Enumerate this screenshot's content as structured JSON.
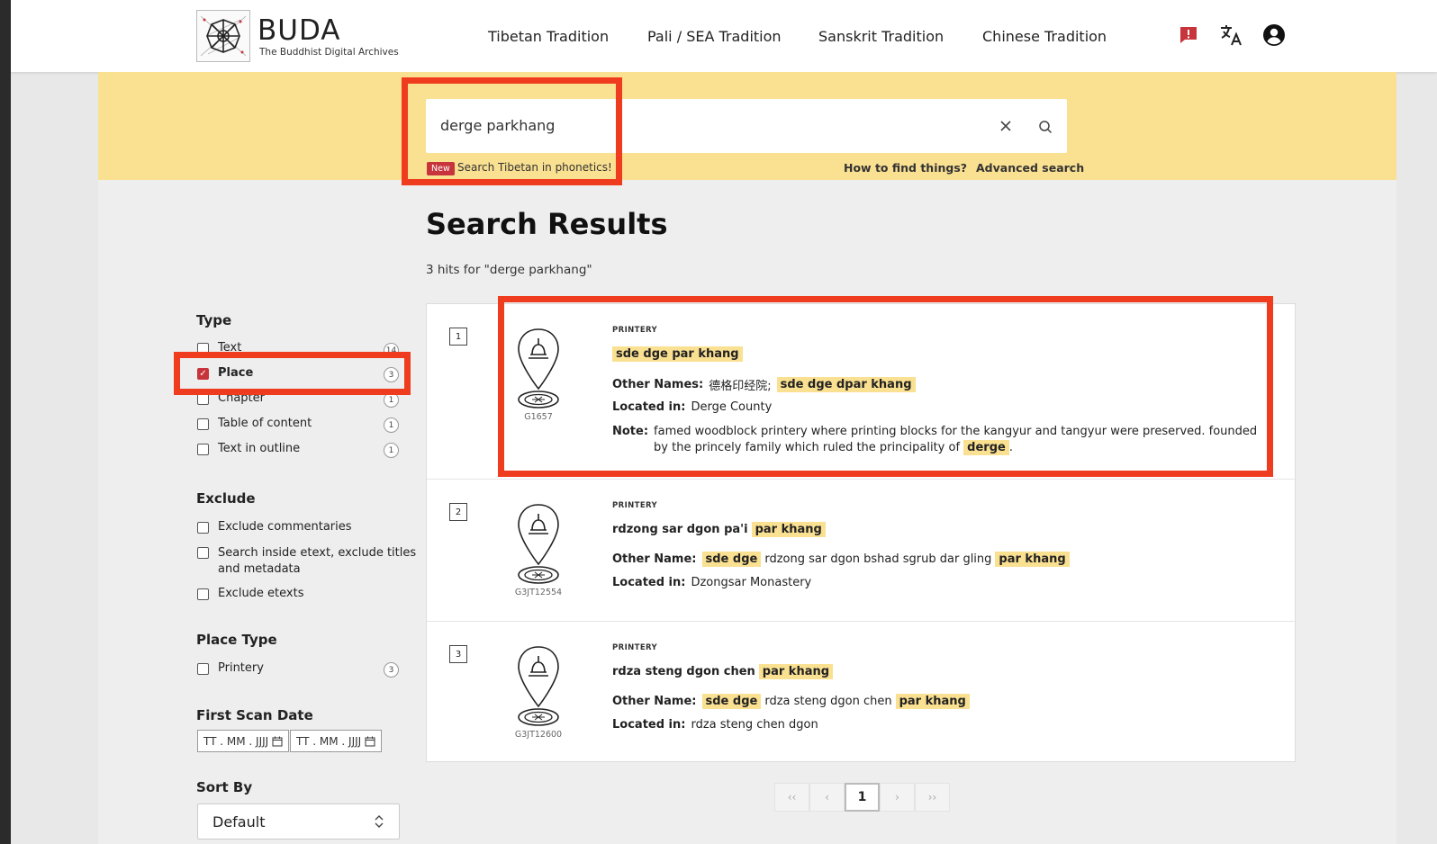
{
  "app": {
    "name": "BUDA",
    "subtitle": "The Buddhist Digital Archives"
  },
  "nav": {
    "items": [
      "Tibetan Tradition",
      "Pali / SEA Tradition",
      "Sanskrit Tradition",
      "Chinese Tradition"
    ],
    "icons": [
      "report-icon",
      "translate-icon",
      "account-icon"
    ]
  },
  "colors": {
    "accent": "#c8343b",
    "band": "#fae091",
    "highlight_box": "#f03c1e"
  },
  "search": {
    "value": "derge parkhang",
    "new_badge": "New",
    "phonetics_link": "Search Tibetan in phonetics!",
    "help_link": "How to find things?",
    "advanced_link": "Advanced search"
  },
  "results": {
    "title": "Search Results",
    "hits": "3 hits for \"derge parkhang\"",
    "items": [
      {
        "num": "1",
        "id": "G1657",
        "type": "PRINTERY",
        "title": "sde dge par khang",
        "other_label": "Other Names:",
        "other_plain": "德格印经院;",
        "other_hl": "sde dge dpar khang",
        "located_label": "Located in:",
        "located": "Derge County",
        "note_label": "Note:",
        "note_text": "famed woodblock printery where printing blocks for the kangyur and tangyur were preserved. founded by the princely family which ruled the principality of",
        "note_hl": "derge",
        "note_end": "."
      },
      {
        "num": "2",
        "id": "G3JT12554",
        "type": "PRINTERY",
        "title_plain": "rdzong sar dgon pa'i",
        "title_hl": "par khang",
        "other_label": "Other Name:",
        "other_hl1": "sde dge",
        "other_plain": "rdzong sar dgon bshad sgrub dar gling",
        "other_hl2": "par khang",
        "located_label": "Located in:",
        "located": "Dzongsar Monastery"
      },
      {
        "num": "3",
        "id": "G3JT12600",
        "type": "PRINTERY",
        "title_plain": "rdza steng dgon chen",
        "title_hl": "par khang",
        "other_label": "Other Name:",
        "other_hl1": "sde dge",
        "other_plain": "rdza steng dgon chen",
        "other_hl2": "par khang",
        "located_label": "Located in:",
        "located": "rdza steng chen dgon"
      }
    ]
  },
  "facets": {
    "type_title": "Type",
    "type_items": [
      {
        "label": "Text",
        "count": "14",
        "checked": false
      },
      {
        "label": "Place",
        "count": "3",
        "checked": true
      },
      {
        "label": "Chapter",
        "count": "1",
        "checked": false
      },
      {
        "label": "Table of content",
        "count": "1",
        "checked": false
      },
      {
        "label": "Text in outline",
        "count": "1",
        "checked": false
      }
    ],
    "exclude_title": "Exclude",
    "exclude_items": [
      "Exclude commentaries",
      "Search inside etext, exclude titles",
      "and metadata",
      "Exclude etexts"
    ],
    "place_type_title": "Place Type",
    "place_type_items": [
      {
        "label": "Printery",
        "count": "3"
      }
    ],
    "scan_date_title": "First Scan Date",
    "date_placeholder": "TT . MM . JJJJ",
    "sort_title": "Sort By",
    "sort_value": "Default"
  },
  "pager": {
    "first": "‹‹",
    "prev": "‹",
    "current": "1",
    "next": "›",
    "last": "››"
  }
}
